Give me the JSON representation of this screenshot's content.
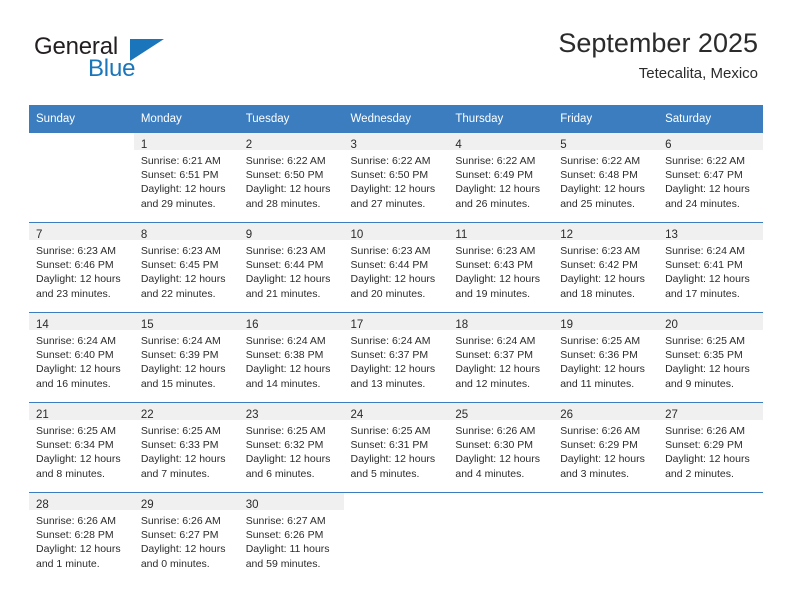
{
  "brand": {
    "name_part1": "General",
    "name_part2": "Blue",
    "accent_color": "#1b75bb"
  },
  "header": {
    "title": "September 2025",
    "location": "Tetecalita, Mexico"
  },
  "theme": {
    "header_row_color": "#3b7dbf",
    "daynum_band_color": "#f0f0f0",
    "text_color": "#2b2b2b"
  },
  "weekday_headers": [
    "Sunday",
    "Monday",
    "Tuesday",
    "Wednesday",
    "Thursday",
    "Friday",
    "Saturday"
  ],
  "weeks": [
    [
      {
        "day": "",
        "sunrise": "",
        "sunset": "",
        "daylight_line1": "",
        "daylight_line2": ""
      },
      {
        "day": "1",
        "sunrise": "Sunrise: 6:21 AM",
        "sunset": "Sunset: 6:51 PM",
        "daylight_line1": "Daylight: 12 hours",
        "daylight_line2": "and 29 minutes."
      },
      {
        "day": "2",
        "sunrise": "Sunrise: 6:22 AM",
        "sunset": "Sunset: 6:50 PM",
        "daylight_line1": "Daylight: 12 hours",
        "daylight_line2": "and 28 minutes."
      },
      {
        "day": "3",
        "sunrise": "Sunrise: 6:22 AM",
        "sunset": "Sunset: 6:50 PM",
        "daylight_line1": "Daylight: 12 hours",
        "daylight_line2": "and 27 minutes."
      },
      {
        "day": "4",
        "sunrise": "Sunrise: 6:22 AM",
        "sunset": "Sunset: 6:49 PM",
        "daylight_line1": "Daylight: 12 hours",
        "daylight_line2": "and 26 minutes."
      },
      {
        "day": "5",
        "sunrise": "Sunrise: 6:22 AM",
        "sunset": "Sunset: 6:48 PM",
        "daylight_line1": "Daylight: 12 hours",
        "daylight_line2": "and 25 minutes."
      },
      {
        "day": "6",
        "sunrise": "Sunrise: 6:22 AM",
        "sunset": "Sunset: 6:47 PM",
        "daylight_line1": "Daylight: 12 hours",
        "daylight_line2": "and 24 minutes."
      }
    ],
    [
      {
        "day": "7",
        "sunrise": "Sunrise: 6:23 AM",
        "sunset": "Sunset: 6:46 PM",
        "daylight_line1": "Daylight: 12 hours",
        "daylight_line2": "and 23 minutes."
      },
      {
        "day": "8",
        "sunrise": "Sunrise: 6:23 AM",
        "sunset": "Sunset: 6:45 PM",
        "daylight_line1": "Daylight: 12 hours",
        "daylight_line2": "and 22 minutes."
      },
      {
        "day": "9",
        "sunrise": "Sunrise: 6:23 AM",
        "sunset": "Sunset: 6:44 PM",
        "daylight_line1": "Daylight: 12 hours",
        "daylight_line2": "and 21 minutes."
      },
      {
        "day": "10",
        "sunrise": "Sunrise: 6:23 AM",
        "sunset": "Sunset: 6:44 PM",
        "daylight_line1": "Daylight: 12 hours",
        "daylight_line2": "and 20 minutes."
      },
      {
        "day": "11",
        "sunrise": "Sunrise: 6:23 AM",
        "sunset": "Sunset: 6:43 PM",
        "daylight_line1": "Daylight: 12 hours",
        "daylight_line2": "and 19 minutes."
      },
      {
        "day": "12",
        "sunrise": "Sunrise: 6:23 AM",
        "sunset": "Sunset: 6:42 PM",
        "daylight_line1": "Daylight: 12 hours",
        "daylight_line2": "and 18 minutes."
      },
      {
        "day": "13",
        "sunrise": "Sunrise: 6:24 AM",
        "sunset": "Sunset: 6:41 PM",
        "daylight_line1": "Daylight: 12 hours",
        "daylight_line2": "and 17 minutes."
      }
    ],
    [
      {
        "day": "14",
        "sunrise": "Sunrise: 6:24 AM",
        "sunset": "Sunset: 6:40 PM",
        "daylight_line1": "Daylight: 12 hours",
        "daylight_line2": "and 16 minutes."
      },
      {
        "day": "15",
        "sunrise": "Sunrise: 6:24 AM",
        "sunset": "Sunset: 6:39 PM",
        "daylight_line1": "Daylight: 12 hours",
        "daylight_line2": "and 15 minutes."
      },
      {
        "day": "16",
        "sunrise": "Sunrise: 6:24 AM",
        "sunset": "Sunset: 6:38 PM",
        "daylight_line1": "Daylight: 12 hours",
        "daylight_line2": "and 14 minutes."
      },
      {
        "day": "17",
        "sunrise": "Sunrise: 6:24 AM",
        "sunset": "Sunset: 6:37 PM",
        "daylight_line1": "Daylight: 12 hours",
        "daylight_line2": "and 13 minutes."
      },
      {
        "day": "18",
        "sunrise": "Sunrise: 6:24 AM",
        "sunset": "Sunset: 6:37 PM",
        "daylight_line1": "Daylight: 12 hours",
        "daylight_line2": "and 12 minutes."
      },
      {
        "day": "19",
        "sunrise": "Sunrise: 6:25 AM",
        "sunset": "Sunset: 6:36 PM",
        "daylight_line1": "Daylight: 12 hours",
        "daylight_line2": "and 11 minutes."
      },
      {
        "day": "20",
        "sunrise": "Sunrise: 6:25 AM",
        "sunset": "Sunset: 6:35 PM",
        "daylight_line1": "Daylight: 12 hours",
        "daylight_line2": "and 9 minutes."
      }
    ],
    [
      {
        "day": "21",
        "sunrise": "Sunrise: 6:25 AM",
        "sunset": "Sunset: 6:34 PM",
        "daylight_line1": "Daylight: 12 hours",
        "daylight_line2": "and 8 minutes."
      },
      {
        "day": "22",
        "sunrise": "Sunrise: 6:25 AM",
        "sunset": "Sunset: 6:33 PM",
        "daylight_line1": "Daylight: 12 hours",
        "daylight_line2": "and 7 minutes."
      },
      {
        "day": "23",
        "sunrise": "Sunrise: 6:25 AM",
        "sunset": "Sunset: 6:32 PM",
        "daylight_line1": "Daylight: 12 hours",
        "daylight_line2": "and 6 minutes."
      },
      {
        "day": "24",
        "sunrise": "Sunrise: 6:25 AM",
        "sunset": "Sunset: 6:31 PM",
        "daylight_line1": "Daylight: 12 hours",
        "daylight_line2": "and 5 minutes."
      },
      {
        "day": "25",
        "sunrise": "Sunrise: 6:26 AM",
        "sunset": "Sunset: 6:30 PM",
        "daylight_line1": "Daylight: 12 hours",
        "daylight_line2": "and 4 minutes."
      },
      {
        "day": "26",
        "sunrise": "Sunrise: 6:26 AM",
        "sunset": "Sunset: 6:29 PM",
        "daylight_line1": "Daylight: 12 hours",
        "daylight_line2": "and 3 minutes."
      },
      {
        "day": "27",
        "sunrise": "Sunrise: 6:26 AM",
        "sunset": "Sunset: 6:29 PM",
        "daylight_line1": "Daylight: 12 hours",
        "daylight_line2": "and 2 minutes."
      }
    ],
    [
      {
        "day": "28",
        "sunrise": "Sunrise: 6:26 AM",
        "sunset": "Sunset: 6:28 PM",
        "daylight_line1": "Daylight: 12 hours",
        "daylight_line2": "and 1 minute."
      },
      {
        "day": "29",
        "sunrise": "Sunrise: 6:26 AM",
        "sunset": "Sunset: 6:27 PM",
        "daylight_line1": "Daylight: 12 hours",
        "daylight_line2": "and 0 minutes."
      },
      {
        "day": "30",
        "sunrise": "Sunrise: 6:27 AM",
        "sunset": "Sunset: 6:26 PM",
        "daylight_line1": "Daylight: 11 hours",
        "daylight_line2": "and 59 minutes."
      },
      {
        "day": "",
        "sunrise": "",
        "sunset": "",
        "daylight_line1": "",
        "daylight_line2": ""
      },
      {
        "day": "",
        "sunrise": "",
        "sunset": "",
        "daylight_line1": "",
        "daylight_line2": ""
      },
      {
        "day": "",
        "sunrise": "",
        "sunset": "",
        "daylight_line1": "",
        "daylight_line2": ""
      },
      {
        "day": "",
        "sunrise": "",
        "sunset": "",
        "daylight_line1": "",
        "daylight_line2": ""
      }
    ]
  ]
}
